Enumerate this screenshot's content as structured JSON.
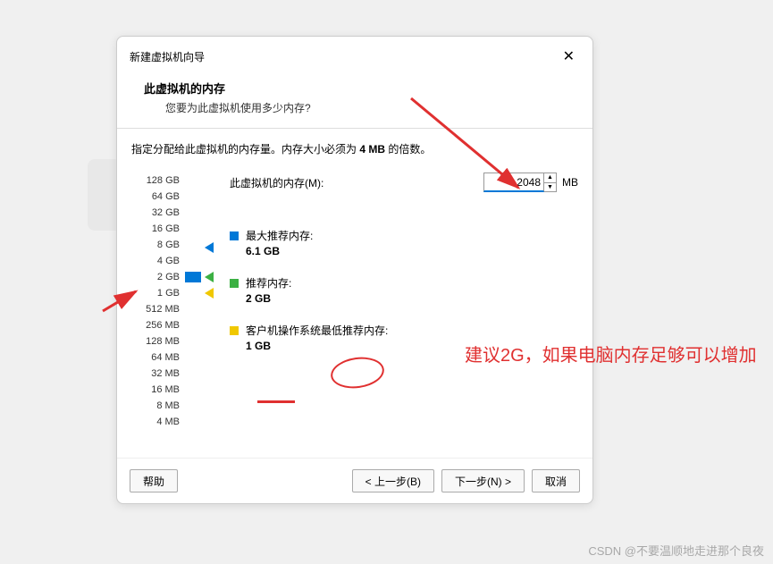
{
  "dialog": {
    "title": "新建虚拟机向导",
    "header_title": "此虚拟机的内存",
    "header_sub": "您要为此虚拟机使用多少内存?",
    "instruction_pre": "指定分配给此虚拟机的内存量。内存大小必须为 ",
    "instruction_bold": "4 MB",
    "instruction_post": " 的倍数。",
    "mem_label": "此虚拟机的内存(M):",
    "mem_value": "2048",
    "mem_unit": "MB",
    "scale": [
      "128 GB",
      "64 GB",
      "32 GB",
      "16 GB",
      "8 GB",
      "4 GB",
      "2 GB",
      "1 GB",
      "512 MB",
      "256 MB",
      "128 MB",
      "64 MB",
      "32 MB",
      "16 MB",
      "8 MB",
      "4 MB"
    ],
    "max_rec_label": "最大推荐内存:",
    "max_rec_value": "6.1 GB",
    "rec_label": "推荐内存:",
    "rec_value": "2 GB",
    "min_rec_label": "客户机操作系统最低推荐内存:",
    "min_rec_value": "1 GB"
  },
  "buttons": {
    "help": "帮助",
    "back": "< 上一步(B)",
    "next": "下一步(N) >",
    "cancel": "取消"
  },
  "annotations": {
    "note": "建议2G，如果电脑内存足够可以增加"
  },
  "watermark": "CSDN @不要温顺地走进那个良夜"
}
